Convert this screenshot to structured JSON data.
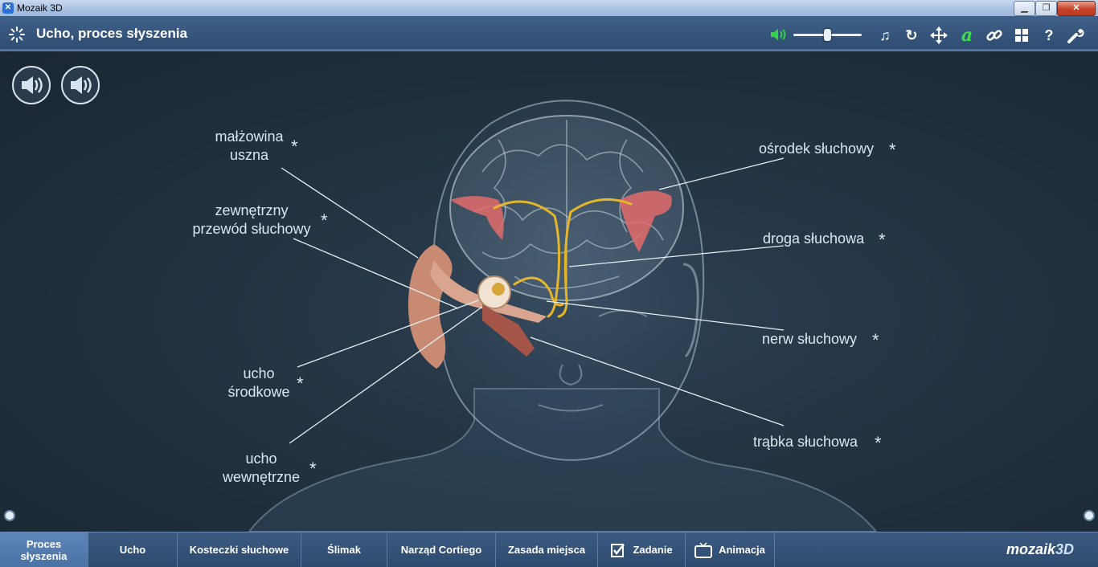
{
  "window": {
    "app_title": "Mozaik 3D",
    "minimize_label": "▁",
    "maximize_label": "❐",
    "close_label": "✕"
  },
  "header": {
    "title": "Ucho, proces słyszenia",
    "volume": 0.5,
    "icons": [
      "loader-icon",
      "speaker-icon",
      "music-icon",
      "reset-icon",
      "move-icon",
      "font-icon",
      "link-icon",
      "grid-icon",
      "help-icon",
      "settings-icon"
    ]
  },
  "labels": {
    "malzowina": {
      "line1": "małżowina",
      "line2": "uszna"
    },
    "przewod": {
      "line1": "zewnętrzny",
      "line2": "przewód słuchowy"
    },
    "srodkowe": {
      "line1": "ucho",
      "line2": "środkowe"
    },
    "wewnetrzne": {
      "line1": "ucho",
      "line2": "wewnętrzne"
    },
    "osrodek": "ośrodek słuchowy",
    "droga": "droga słuchowa",
    "nerw": "nerw słuchowy",
    "trabka": "trąbka słuchowa",
    "star": "*"
  },
  "tabs": [
    {
      "label_1": "Proces",
      "label_2": "słyszenia",
      "active": true
    },
    {
      "label": "Ucho"
    },
    {
      "label": "Kosteczki słuchowe"
    },
    {
      "label": "Ślimak"
    },
    {
      "label": "Narząd Cortiego"
    },
    {
      "label": "Zasada miejsca"
    },
    {
      "label": "Zadanie",
      "icon": "task-icon"
    },
    {
      "label": "Animacja",
      "icon": "tv-icon"
    }
  ],
  "brand": {
    "part1": "mozaik",
    "part2": "3D"
  },
  "colors": {
    "accent": "#3f6088",
    "nerve": "#e5b62a",
    "auditory_cortex": "#e26b6b",
    "ear": "#c98a72"
  }
}
